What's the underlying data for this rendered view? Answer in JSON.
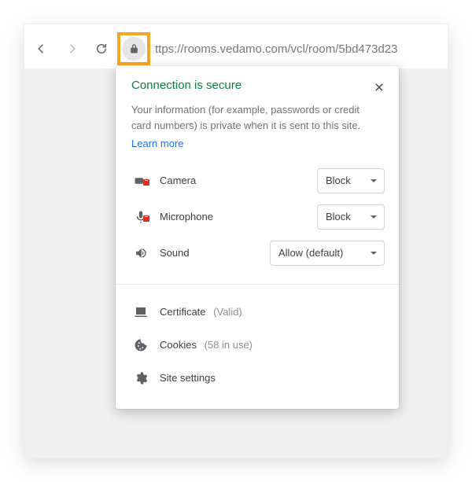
{
  "omnibox": {
    "url_display": "ttps://rooms.vedamo.com/vcl/room/5bd473d23"
  },
  "popover": {
    "title": "Connection is secure",
    "description": "Your information (for example, passwords or credit card numbers) is private when it is sent to this site.",
    "learn_more_label": "Learn more",
    "permissions": [
      {
        "name": "Camera",
        "value": "Block",
        "kind": "camera",
        "blocked": true
      },
      {
        "name": "Microphone",
        "value": "Block",
        "kind": "microphone",
        "blocked": true
      },
      {
        "name": "Sound",
        "value": "Allow (default)",
        "kind": "sound",
        "blocked": false
      }
    ],
    "certificate": {
      "label": "Certificate",
      "status": "(Valid)"
    },
    "cookies": {
      "label": "Cookies",
      "status": "(58 in use)"
    },
    "site_settings_label": "Site settings"
  }
}
